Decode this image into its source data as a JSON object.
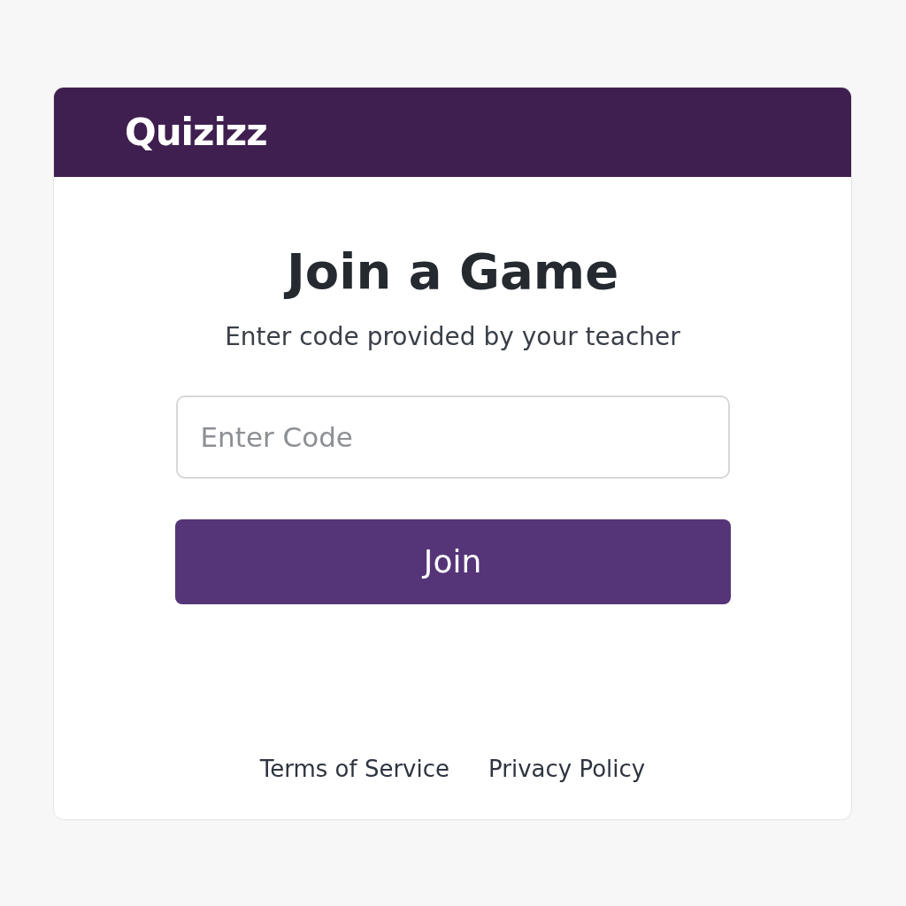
{
  "header": {
    "logo": "Quizizz"
  },
  "title": "Join a Game",
  "subtitle": "Enter code provided by your teacher",
  "code_field": {
    "placeholder": "Enter Code"
  },
  "join_button": "Join",
  "footer_links": [
    "Terms of Service",
    "Privacy Policy"
  ]
}
